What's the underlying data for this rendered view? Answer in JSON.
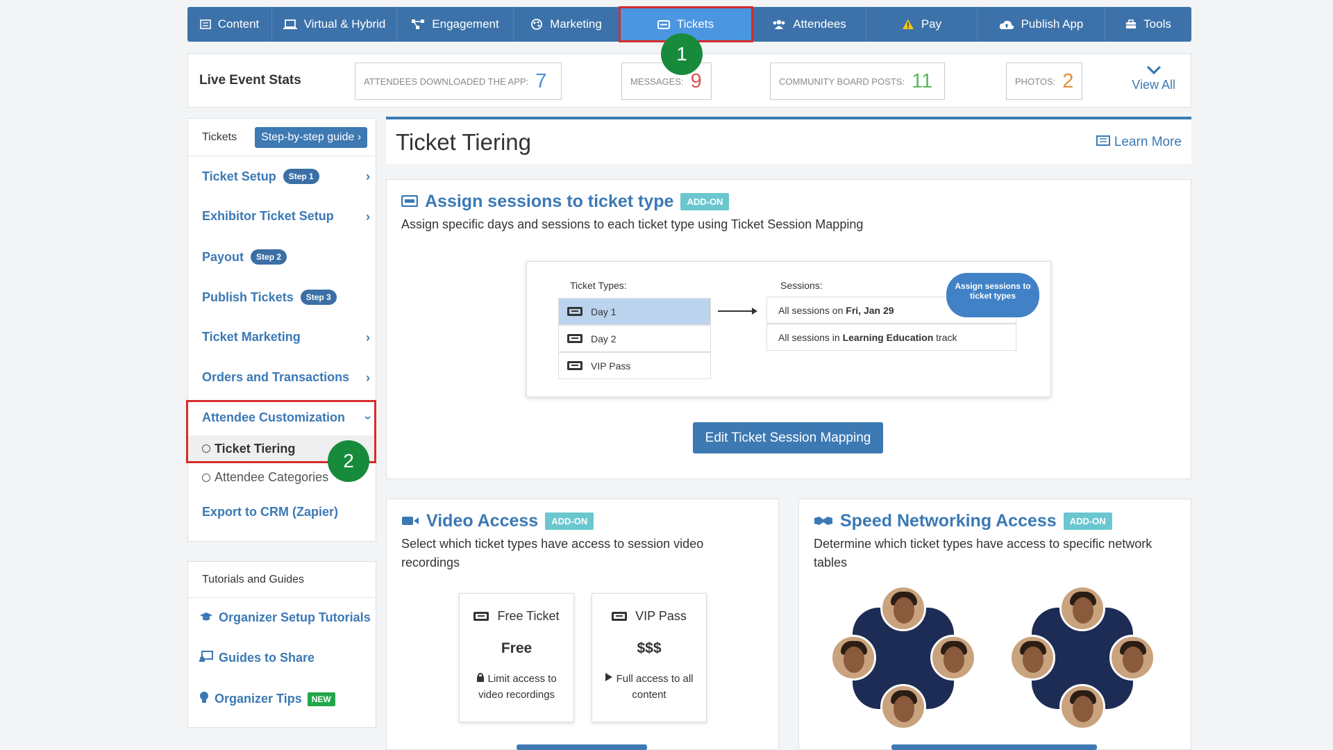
{
  "topnav": {
    "tabs": [
      {
        "label": "Content",
        "icon": "content-icon"
      },
      {
        "label": "Virtual & Hybrid",
        "icon": "laptop-icon"
      },
      {
        "label": "Engagement",
        "icon": "network-icon"
      },
      {
        "label": "Marketing",
        "icon": "marketing-icon"
      },
      {
        "label": "Tickets",
        "icon": "ticket-icon",
        "active": true
      },
      {
        "label": "Attendees",
        "icon": "users-icon"
      },
      {
        "label": "Pay",
        "icon": "warning-icon"
      },
      {
        "label": "Publish App",
        "icon": "cloud-upload-icon"
      },
      {
        "label": "Tools",
        "icon": "toolbox-icon"
      }
    ]
  },
  "stats": {
    "title": "Live Event Stats",
    "items": [
      {
        "label": "ATTENDEES DOWNLOADED THE APP:",
        "value": "7",
        "color": "#4a8fd4"
      },
      {
        "label": "MESSAGES:",
        "value": "9",
        "color": "#d9534f"
      },
      {
        "label": "COMMUNITY BOARD POSTS:",
        "value": "11",
        "color": "#5cb85c"
      },
      {
        "label": "PHOTOS:",
        "value": "2",
        "color": "#e0913a"
      }
    ],
    "view_all": "View All"
  },
  "sidebar": {
    "header": "Tickets",
    "guide_button": "Step-by-step guide",
    "items": [
      {
        "label": "Ticket Setup",
        "step": "Step 1"
      },
      {
        "label": "Exhibitor Ticket Setup"
      },
      {
        "label": "Payout",
        "step": "Step 2"
      },
      {
        "label": "Publish Tickets",
        "step": "Step 3"
      },
      {
        "label": "Ticket Marketing"
      },
      {
        "label": "Orders and Transactions"
      },
      {
        "label": "Attendee Customization"
      }
    ],
    "subitems": [
      {
        "label": "Ticket Tiering",
        "active": true
      },
      {
        "label": "Attendee Categories"
      }
    ],
    "export": "Export to CRM (Zapier)"
  },
  "tutorials": {
    "header": "Tutorials and Guides",
    "items": [
      {
        "label": "Organizer Setup Tutorials",
        "icon": "graduation-cap-icon"
      },
      {
        "label": "Guides to Share",
        "icon": "share-screen-icon"
      },
      {
        "label": "Organizer Tips",
        "icon": "lightbulb-icon",
        "badge": "NEW"
      }
    ]
  },
  "annotations": {
    "step1": "1",
    "step2": "2"
  },
  "main": {
    "title": "Ticket Tiering",
    "learn_more": "Learn More"
  },
  "assign": {
    "title": "Assign sessions to ticket type",
    "badge": "ADD-ON",
    "desc": "Assign specific days and sessions to each ticket type using Ticket Session Mapping",
    "illus": {
      "ticket_types_label": "Ticket Types:",
      "sessions_label": "Sessions:",
      "ticket_types": [
        "Day 1",
        "Day 2",
        "VIP Pass"
      ],
      "sessions": [
        {
          "prefix": "All sessions on ",
          "bold": "Fri, Jan 29",
          "suffix": ""
        },
        {
          "prefix": "All sessions in ",
          "bold": "Learning Education",
          "suffix": " track"
        }
      ],
      "bubble": "Assign sessions to ticket types"
    },
    "button": "Edit Ticket Session Mapping"
  },
  "video": {
    "title": "Video Access",
    "badge": "ADD-ON",
    "desc": "Select which ticket types have access to session video recordings",
    "cards": [
      {
        "title": "Free Ticket",
        "price": "Free",
        "desc": "Limit access to video recordings",
        "icon": "lock-icon"
      },
      {
        "title": "VIP Pass",
        "price": "$$$",
        "desc": "Full access to all content",
        "icon": "play-icon"
      }
    ]
  },
  "networking": {
    "title": "Speed Networking Access",
    "badge": "ADD-ON",
    "desc": "Determine which ticket types have access to specific network tables"
  }
}
